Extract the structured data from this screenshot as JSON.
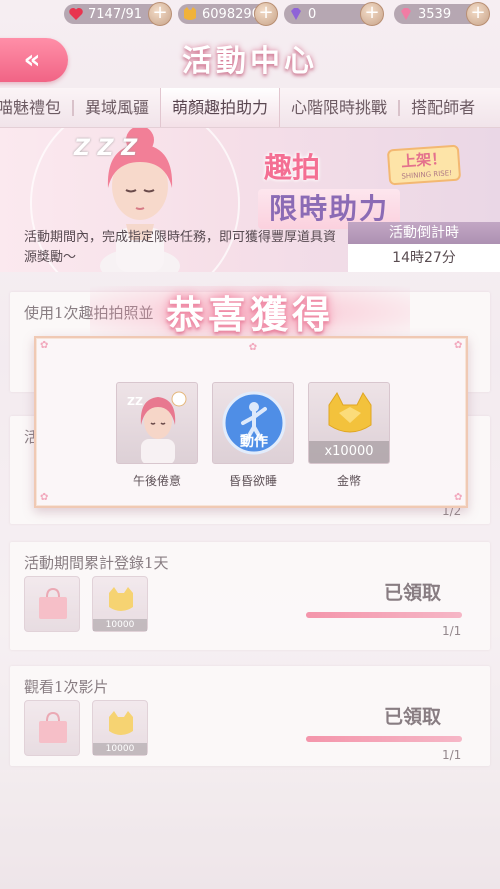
{
  "currencies": [
    {
      "value": "7147/91",
      "icon": "heart-icon",
      "color": "#e8344f"
    },
    {
      "value": "6098290",
      "icon": "cat-coin-icon",
      "color": "#f0b23a"
    },
    {
      "value": "0",
      "icon": "purple-diamond-icon",
      "color": "#8f63d8"
    },
    {
      "value": "3539",
      "icon": "pink-diamond-icon",
      "color": "#f07ca4"
    }
  ],
  "header": {
    "back_label": "«",
    "title": "活動中心"
  },
  "tabs": [
    "喵魅禮包",
    "異域風疆",
    "萌顏趣拍助力",
    "心階限時挑戰",
    "搭配師者"
  ],
  "active_tab_index": 2,
  "banner": {
    "title_line1": "趣拍",
    "title_line2": "限時助力",
    "badge": "上架！",
    "badge_sub": "SHINING RISE!",
    "description": "活動期間內，完成指定限時任務，即可獲得豐厚道具資源獎勵～",
    "countdown_label": "活動倒計時",
    "countdown_value": "14時27分",
    "zzz": "Z Z Z"
  },
  "quests": [
    {
      "title": "使用1次趣拍拍照並"
    },
    {
      "title": "活",
      "progress": "1/2"
    },
    {
      "title": "活動期間累計登錄1天",
      "rewards": [
        {
          "name": "gift-bag"
        },
        {
          "name": "gold-coin",
          "count": "10000"
        }
      ],
      "status": "已領取",
      "progress": "1/1",
      "progress_fraction": 1.0
    },
    {
      "title": "觀看1次影片",
      "rewards": [
        {
          "name": "gift-bag"
        },
        {
          "name": "gold-coin",
          "count": "10000"
        }
      ],
      "status": "已領取",
      "progress": "1/1",
      "progress_fraction": 1.0
    }
  ],
  "popup": {
    "title": "恭喜獲得",
    "rewards": [
      {
        "label": "午後倦意",
        "icon": "sleepy-girl-avatar"
      },
      {
        "label": "昏昏欲睡",
        "icon": "action-icon",
        "tag": "動作"
      },
      {
        "label": "金幣",
        "icon": "gold-coin-icon",
        "count": "x10000"
      }
    ]
  }
}
